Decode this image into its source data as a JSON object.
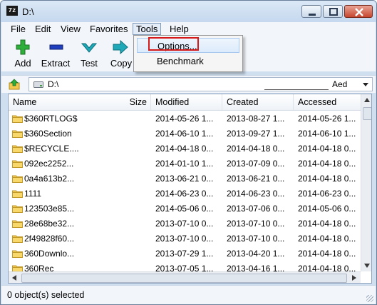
{
  "window": {
    "title": "D:\\",
    "app_icon_text": "7z"
  },
  "menu": [
    "File",
    "Edit",
    "View",
    "Favorites",
    "Tools",
    "Help"
  ],
  "toolbar": {
    "add_label": "Add",
    "extract_label": "Extract",
    "test_label": "Test",
    "copy_label": "Copy"
  },
  "tools_menu": {
    "options_label": "Options...",
    "benchmark_label": "Benchmark"
  },
  "address": {
    "path": "D:\\",
    "trail_text": "Aed"
  },
  "columns": [
    "Name",
    "Size",
    "Modified",
    "Created",
    "Accessed"
  ],
  "rows": [
    {
      "name": "$360RTLOG$",
      "size": "",
      "modified": "2014-05-26 1...",
      "created": "2013-08-27 1...",
      "accessed": "2014-05-26 1..."
    },
    {
      "name": "$360Section",
      "size": "",
      "modified": "2014-06-10 1...",
      "created": "2013-09-27 1...",
      "accessed": "2014-06-10 1..."
    },
    {
      "name": "$RECYCLE....",
      "size": "",
      "modified": "2014-04-18 0...",
      "created": "2014-04-18 0...",
      "accessed": "2014-04-18 0..."
    },
    {
      "name": "092ec2252...",
      "size": "",
      "modified": "2014-01-10 1...",
      "created": "2013-07-09 0...",
      "accessed": "2014-04-18 0..."
    },
    {
      "name": "0a4a613b2...",
      "size": "",
      "modified": "2013-06-21 0...",
      "created": "2013-06-21 0...",
      "accessed": "2014-04-18 0..."
    },
    {
      "name": "1111",
      "size": "",
      "modified": "2014-06-23 0...",
      "created": "2014-06-23 0...",
      "accessed": "2014-06-23 0..."
    },
    {
      "name": "123503e85...",
      "size": "",
      "modified": "2014-05-06 0...",
      "created": "2013-07-06 0...",
      "accessed": "2014-05-06 0..."
    },
    {
      "name": "28e68be32...",
      "size": "",
      "modified": "2013-07-10 0...",
      "created": "2013-07-10 0...",
      "accessed": "2014-04-18 0..."
    },
    {
      "name": "2f49828f60...",
      "size": "",
      "modified": "2013-07-10 0...",
      "created": "2013-07-10 0...",
      "accessed": "2014-04-18 0..."
    },
    {
      "name": "360Downlo...",
      "size": "",
      "modified": "2013-07-29 1...",
      "created": "2013-04-20 1...",
      "accessed": "2014-04-18 0..."
    },
    {
      "name": "360Rec",
      "size": "",
      "modified": "2013-07-05 1...",
      "created": "2013-04-16 1...",
      "accessed": "2014-04-18 0..."
    }
  ],
  "status": {
    "text": "0 object(s) selected"
  },
  "colors": {
    "accent_highlight": "#d61a1a",
    "folder": "#f2c94c",
    "add_icon": "#2eae3a",
    "extract_icon": "#1f3fbf",
    "test_icon": "#1fa8b8"
  }
}
